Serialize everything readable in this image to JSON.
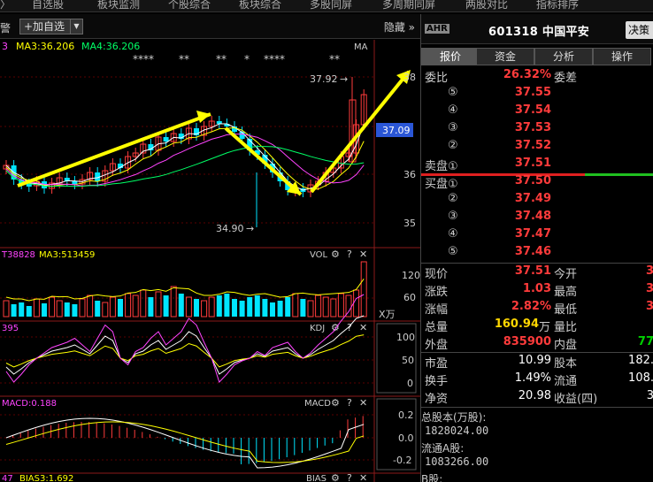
{
  "top_tabs": [
    "自选股",
    "板块监测",
    "个股综合",
    "板块综合",
    "多股同屏",
    "多周期同屏",
    "两股对比",
    "指标排序"
  ],
  "toolbar": {
    "warn_label": "警",
    "add_label": "+加自选",
    "hide_label": "隐藏",
    "hide_arrow": "»"
  },
  "chart": {
    "ma_row": {
      "ma3": "3",
      "ma3_text": "MA3:36.206",
      "ma4_text": "MA4:36.206",
      "tag": "MA"
    },
    "stars": [
      "****",
      "**",
      "**",
      "*",
      "****",
      "**"
    ],
    "high_label": "37.92",
    "low_label": "34.90",
    "price_tag": "37.09",
    "y_ticks": [
      "38",
      "37",
      "36",
      "35"
    ],
    "vol": {
      "left": "T38828",
      "ma3": "MA3:513459",
      "tag": "VOL",
      "ticks": [
        "120",
        "60"
      ],
      "unit": "X万"
    },
    "kdj": {
      "left": "395",
      "tag": "KDJ",
      "ticks": [
        "100",
        "50",
        "0"
      ]
    },
    "macd": {
      "left": "MACD:0.188",
      "tag": "MACD",
      "ticks": [
        "0.2",
        "0.0",
        "-0.2"
      ]
    },
    "bias": {
      "left": "47",
      "value": "BIAS3:1.692",
      "tag": "BIAS"
    },
    "gear": "⚙",
    "question": "?",
    "close": "✕",
    "colors": {
      "up": "#ff3b3b",
      "down": "#00e5ff",
      "arrow": "#ffff00",
      "ma_white": "#ffffff",
      "ma_yellow": "#ffff00",
      "ma_green": "#00ff66",
      "ma_magenta": "#ff44ff"
    }
  },
  "panel": {
    "badge": "AHR",
    "code": "601318",
    "name": "中国平安",
    "decide_label": "决策",
    "tabs": [
      "报价",
      "资金",
      "分析",
      "操作"
    ],
    "wei": {
      "label": "委比",
      "value": "26.32%",
      "label2": "委差"
    },
    "sell": [
      {
        "label": "⑤",
        "price": "37.55"
      },
      {
        "label": "④",
        "price": "37.54"
      },
      {
        "label": "③",
        "price": "37.53"
      },
      {
        "label": "②",
        "price": "37.52"
      },
      {
        "label": "卖盘①",
        "price": "37.51"
      }
    ],
    "buy": [
      {
        "label": "买盘①",
        "price": "37.50"
      },
      {
        "label": "②",
        "price": "37.49"
      },
      {
        "label": "③",
        "price": "37.48"
      },
      {
        "label": "④",
        "price": "37.47"
      },
      {
        "label": "⑤",
        "price": "37.46"
      }
    ],
    "stats": [
      {
        "k": "现价",
        "v": "37.51",
        "k2": "今开",
        "v2": "3"
      },
      {
        "k": "涨跌",
        "v": "1.03",
        "k2": "最高",
        "v2": "3"
      },
      {
        "k": "涨幅",
        "v": "2.82%",
        "k2": "最低",
        "v2": "3"
      },
      {
        "k": "总量",
        "v": "160.94",
        "unit": "万",
        "k2": "量比",
        "v2": ""
      },
      {
        "k": "外盘",
        "v": "835900",
        "k2": "内盘",
        "v2": "77"
      }
    ],
    "stats2": [
      {
        "k": "市盈",
        "v": "10.99",
        "k2": "股本",
        "v2": "182."
      },
      {
        "k": "换手",
        "v": "1.49%",
        "k2": "流通",
        "v2": "108."
      },
      {
        "k": "净资",
        "v": "20.98",
        "k2": "收益(四)",
        "v2": "3"
      }
    ],
    "total_label": "总股本(万股):",
    "total_value": "1828024.00",
    "float_label": "流通A股:",
    "float_value": "1083266.00",
    "b_label": "B股:"
  }
}
